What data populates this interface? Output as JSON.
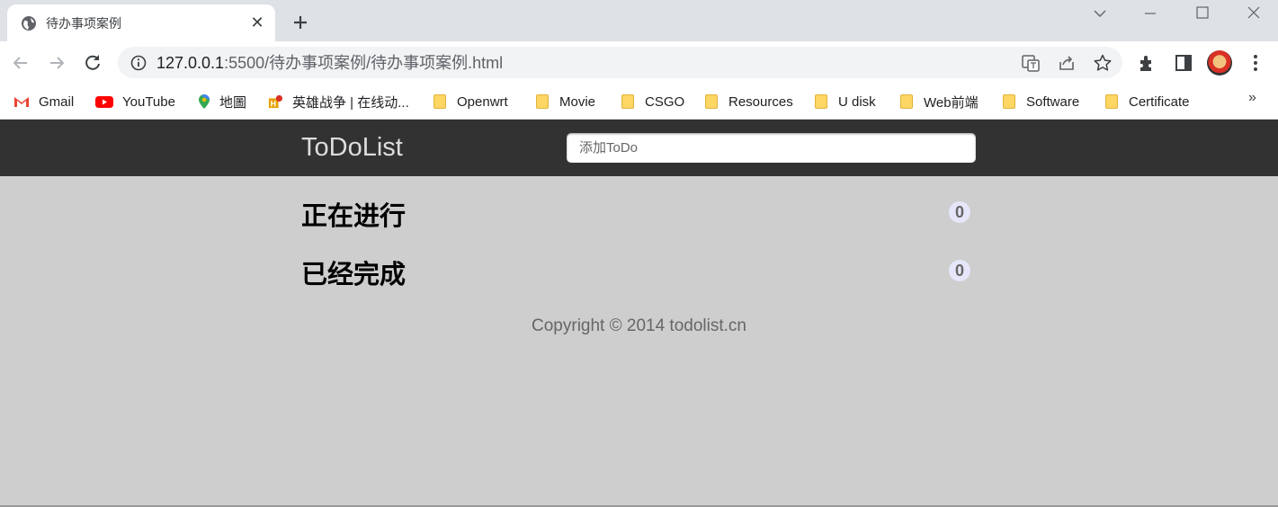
{
  "browser": {
    "tab": {
      "title": "待办事项案例",
      "close": "✕"
    },
    "window_controls": [
      "chevron-down-icon",
      "minimize-icon",
      "maximize-icon",
      "close-window-icon"
    ],
    "url": {
      "host": "127.0.0.1",
      "path": ":5500/待办事项案例/待办事项案例.html"
    },
    "bookmarks": [
      {
        "label": "Gmail",
        "icon": "gmail-icon"
      },
      {
        "label": "YouTube",
        "icon": "youtube-icon"
      },
      {
        "label": "地圖",
        "icon": "maps-icon"
      },
      {
        "label": "英雄战争 | 在线动...",
        "icon": "site-icon"
      },
      {
        "label": "Openwrt",
        "icon": "folder-icon"
      },
      {
        "label": "Movie",
        "icon": "folder-icon"
      },
      {
        "label": "CSGO",
        "icon": "folder-icon"
      },
      {
        "label": "Resources",
        "icon": "folder-icon"
      },
      {
        "label": "U disk",
        "icon": "folder-icon"
      },
      {
        "label": "Web前端",
        "icon": "folder-icon"
      },
      {
        "label": "Software",
        "icon": "folder-icon"
      },
      {
        "label": "Certificate",
        "icon": "folder-icon"
      }
    ],
    "bookmarks_more": "»"
  },
  "page": {
    "logo": "ToDoList",
    "input_placeholder": "添加ToDo",
    "sections": [
      {
        "title": "正在进行",
        "count": "0"
      },
      {
        "title": "已经完成",
        "count": "0"
      }
    ],
    "footer": "Copyright © 2014 todolist.cn"
  },
  "colors": {
    "header_bg": "#323232",
    "page_bg": "#cdcecd",
    "badge_bg": "#e6e6fa"
  }
}
